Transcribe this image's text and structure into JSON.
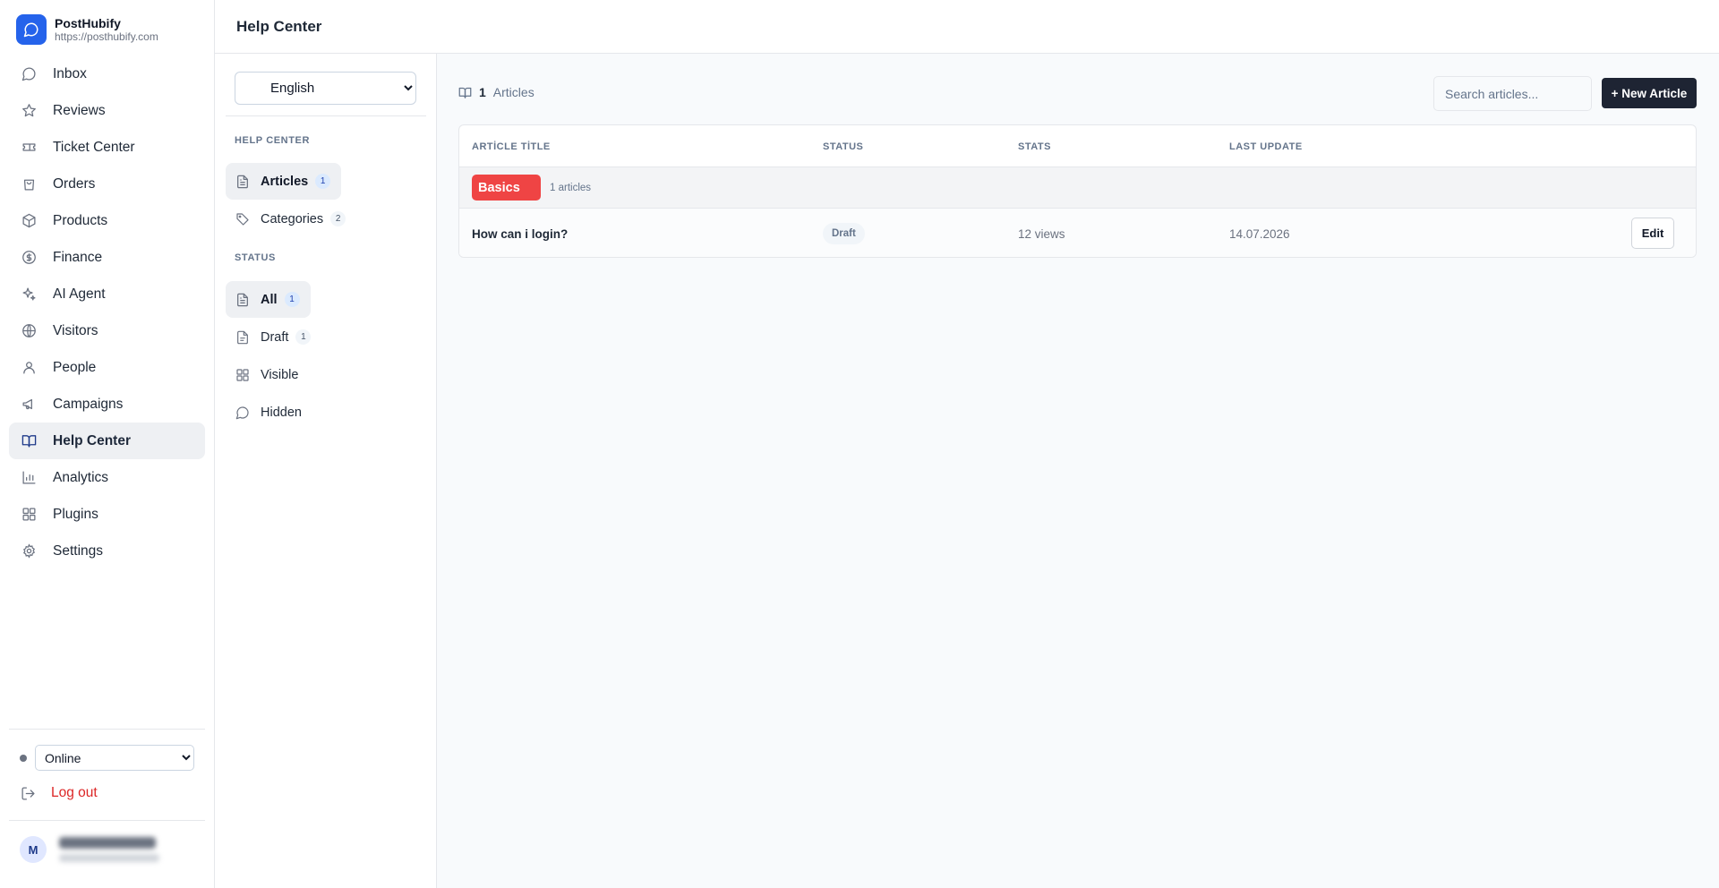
{
  "app": {
    "name": "PostHubify",
    "url": "https://posthubify.com"
  },
  "nav": {
    "items": [
      {
        "label": "Inbox",
        "icon": "message-circle-icon"
      },
      {
        "label": "Reviews",
        "icon": "star-icon"
      },
      {
        "label": "Ticket Center",
        "icon": "ticket-icon"
      },
      {
        "label": "Orders",
        "icon": "shopping-bag-icon"
      },
      {
        "label": "Products",
        "icon": "package-icon"
      },
      {
        "label": "Finance",
        "icon": "dollar-circle-icon"
      },
      {
        "label": "AI Agent",
        "icon": "sparkles-icon"
      },
      {
        "label": "Visitors",
        "icon": "globe-icon"
      },
      {
        "label": "People",
        "icon": "user-icon"
      },
      {
        "label": "Campaigns",
        "icon": "megaphone-icon"
      },
      {
        "label": "Help Center",
        "icon": "book-open-icon",
        "active": true
      },
      {
        "label": "Analytics",
        "icon": "bar-chart-icon"
      },
      {
        "label": "Plugins",
        "icon": "grid-icon"
      },
      {
        "label": "Settings",
        "icon": "gear-icon"
      }
    ],
    "status": {
      "selected": "Online"
    },
    "logout_label": "Log out",
    "user_initial": "M"
  },
  "header": {
    "title": "Help Center"
  },
  "sidebar": {
    "language": {
      "selected": "English"
    },
    "help_center_heading": "HELP CENTER",
    "help_center_items": [
      {
        "label": "Articles",
        "count": "1",
        "icon": "file-text-icon",
        "active": true
      },
      {
        "label": "Categories",
        "count": "2",
        "icon": "tag-icon"
      }
    ],
    "status_heading": "STATUS",
    "status_items": [
      {
        "label": "All",
        "count": "1",
        "icon": "file-text-icon",
        "active": true
      },
      {
        "label": "Draft",
        "count": "1",
        "icon": "file-icon"
      },
      {
        "label": "Visible",
        "icon": "grid-icon"
      },
      {
        "label": "Hidden",
        "icon": "message-circle-icon"
      }
    ]
  },
  "main": {
    "article_count": "1",
    "article_count_label": "Articles",
    "search_placeholder": "Search articles...",
    "new_article_label": "+ New Article",
    "table": {
      "headers": [
        "ARTİCLE TİTLE",
        "STATUS",
        "STATS",
        "LAST UPDATE"
      ],
      "groups": [
        {
          "category": "Basics",
          "color": "#ef4444",
          "count_label": "1 articles",
          "rows": [
            {
              "title": "How can i login?",
              "status": "Draft",
              "stats": "12 views",
              "last_update": "14.07.2026",
              "action": "Edit"
            }
          ]
        }
      ]
    }
  },
  "colors": {
    "accent": "#2563eb",
    "primary_button": "#1e2433",
    "danger": "#dc2626",
    "category_basics": "#ef4444"
  }
}
